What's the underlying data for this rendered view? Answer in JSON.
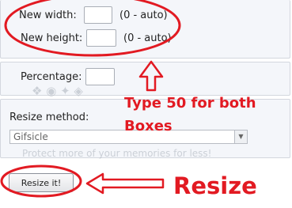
{
  "form": {
    "width": {
      "label": "New width:",
      "value": "",
      "hint": "(0 - auto)"
    },
    "height": {
      "label": "New height:",
      "value": "",
      "hint": "(0 - auto)"
    },
    "percentage": {
      "label": "Percentage:",
      "value": ""
    },
    "method": {
      "label": "Resize method:",
      "selected": "Gifsicle"
    },
    "submit_label": "Resize it!"
  },
  "annotations": {
    "instruction_line1": "Type 50 for both",
    "instruction_line2": "Boxes",
    "resize_callout": "Resize",
    "color": "#e21a22"
  },
  "background_watermark": {
    "line1": "Protect more of your memories for less!"
  },
  "icons": {
    "up_arrow": "up-arrow-outline-icon",
    "left_arrow": "left-arrow-outline-icon",
    "select_arrow": "chevron-down-icon"
  }
}
